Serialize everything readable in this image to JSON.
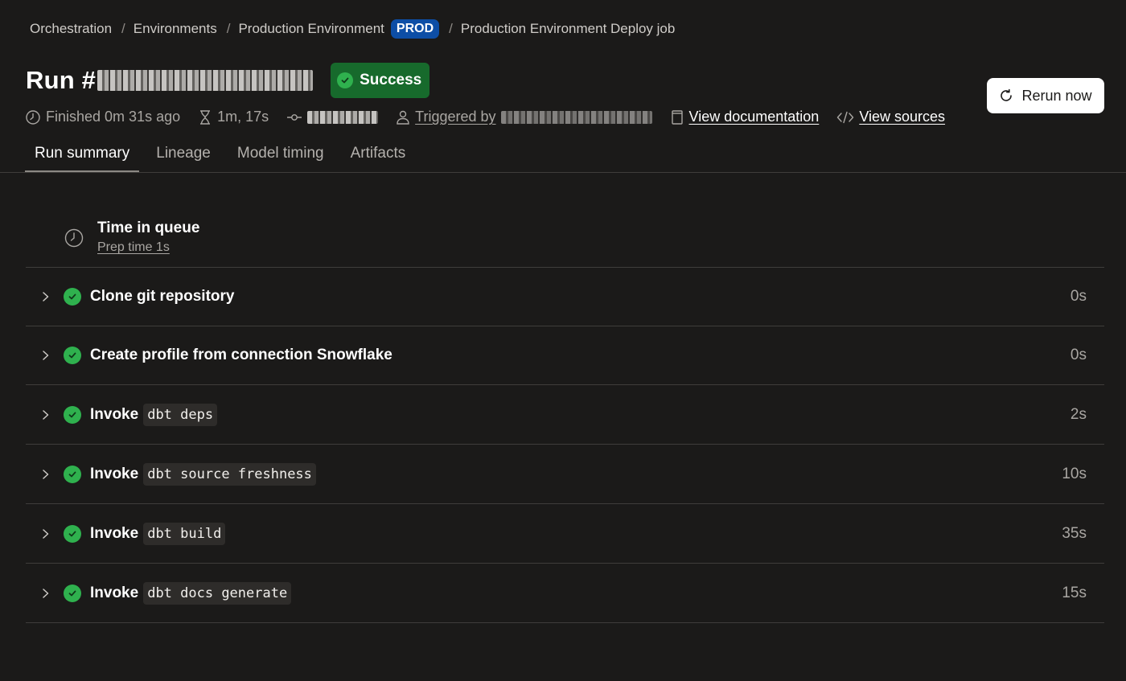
{
  "breadcrumb": {
    "items": [
      "Orchestration",
      "Environments",
      "Production Environment"
    ],
    "env_badge": "PROD",
    "current": "Production Environment Deploy job",
    "separator": "/"
  },
  "run": {
    "title_prefix": "Run #",
    "status": "Success"
  },
  "actions": {
    "rerun": "Rerun now"
  },
  "meta": {
    "finished": "Finished 0m 31s ago",
    "duration": "1m, 17s",
    "triggered_by": "Triggered by",
    "view_docs": "View documentation",
    "view_sources": "View sources"
  },
  "tabs": [
    {
      "label": "Run summary",
      "active": true
    },
    {
      "label": "Lineage",
      "active": false
    },
    {
      "label": "Model timing",
      "active": false
    },
    {
      "label": "Artifacts",
      "active": false
    }
  ],
  "queue": {
    "title": "Time in queue",
    "prep": "Prep time 1s"
  },
  "steps": [
    {
      "prefix": "Clone git repository",
      "code": "",
      "duration": "0s"
    },
    {
      "prefix": "Create profile from connection Snowflake",
      "code": "",
      "duration": "0s"
    },
    {
      "prefix": "Invoke",
      "code": "dbt deps",
      "duration": "2s"
    },
    {
      "prefix": "Invoke",
      "code": "dbt source freshness",
      "duration": "10s"
    },
    {
      "prefix": "Invoke",
      "code": "dbt build",
      "duration": "35s"
    },
    {
      "prefix": "Invoke",
      "code": "dbt docs generate",
      "duration": "15s"
    }
  ],
  "colors": {
    "background": "#1b1a19",
    "success_bg": "#176a2c",
    "success_icon": "#2fb14e",
    "env_badge": "#0d4ea6"
  }
}
